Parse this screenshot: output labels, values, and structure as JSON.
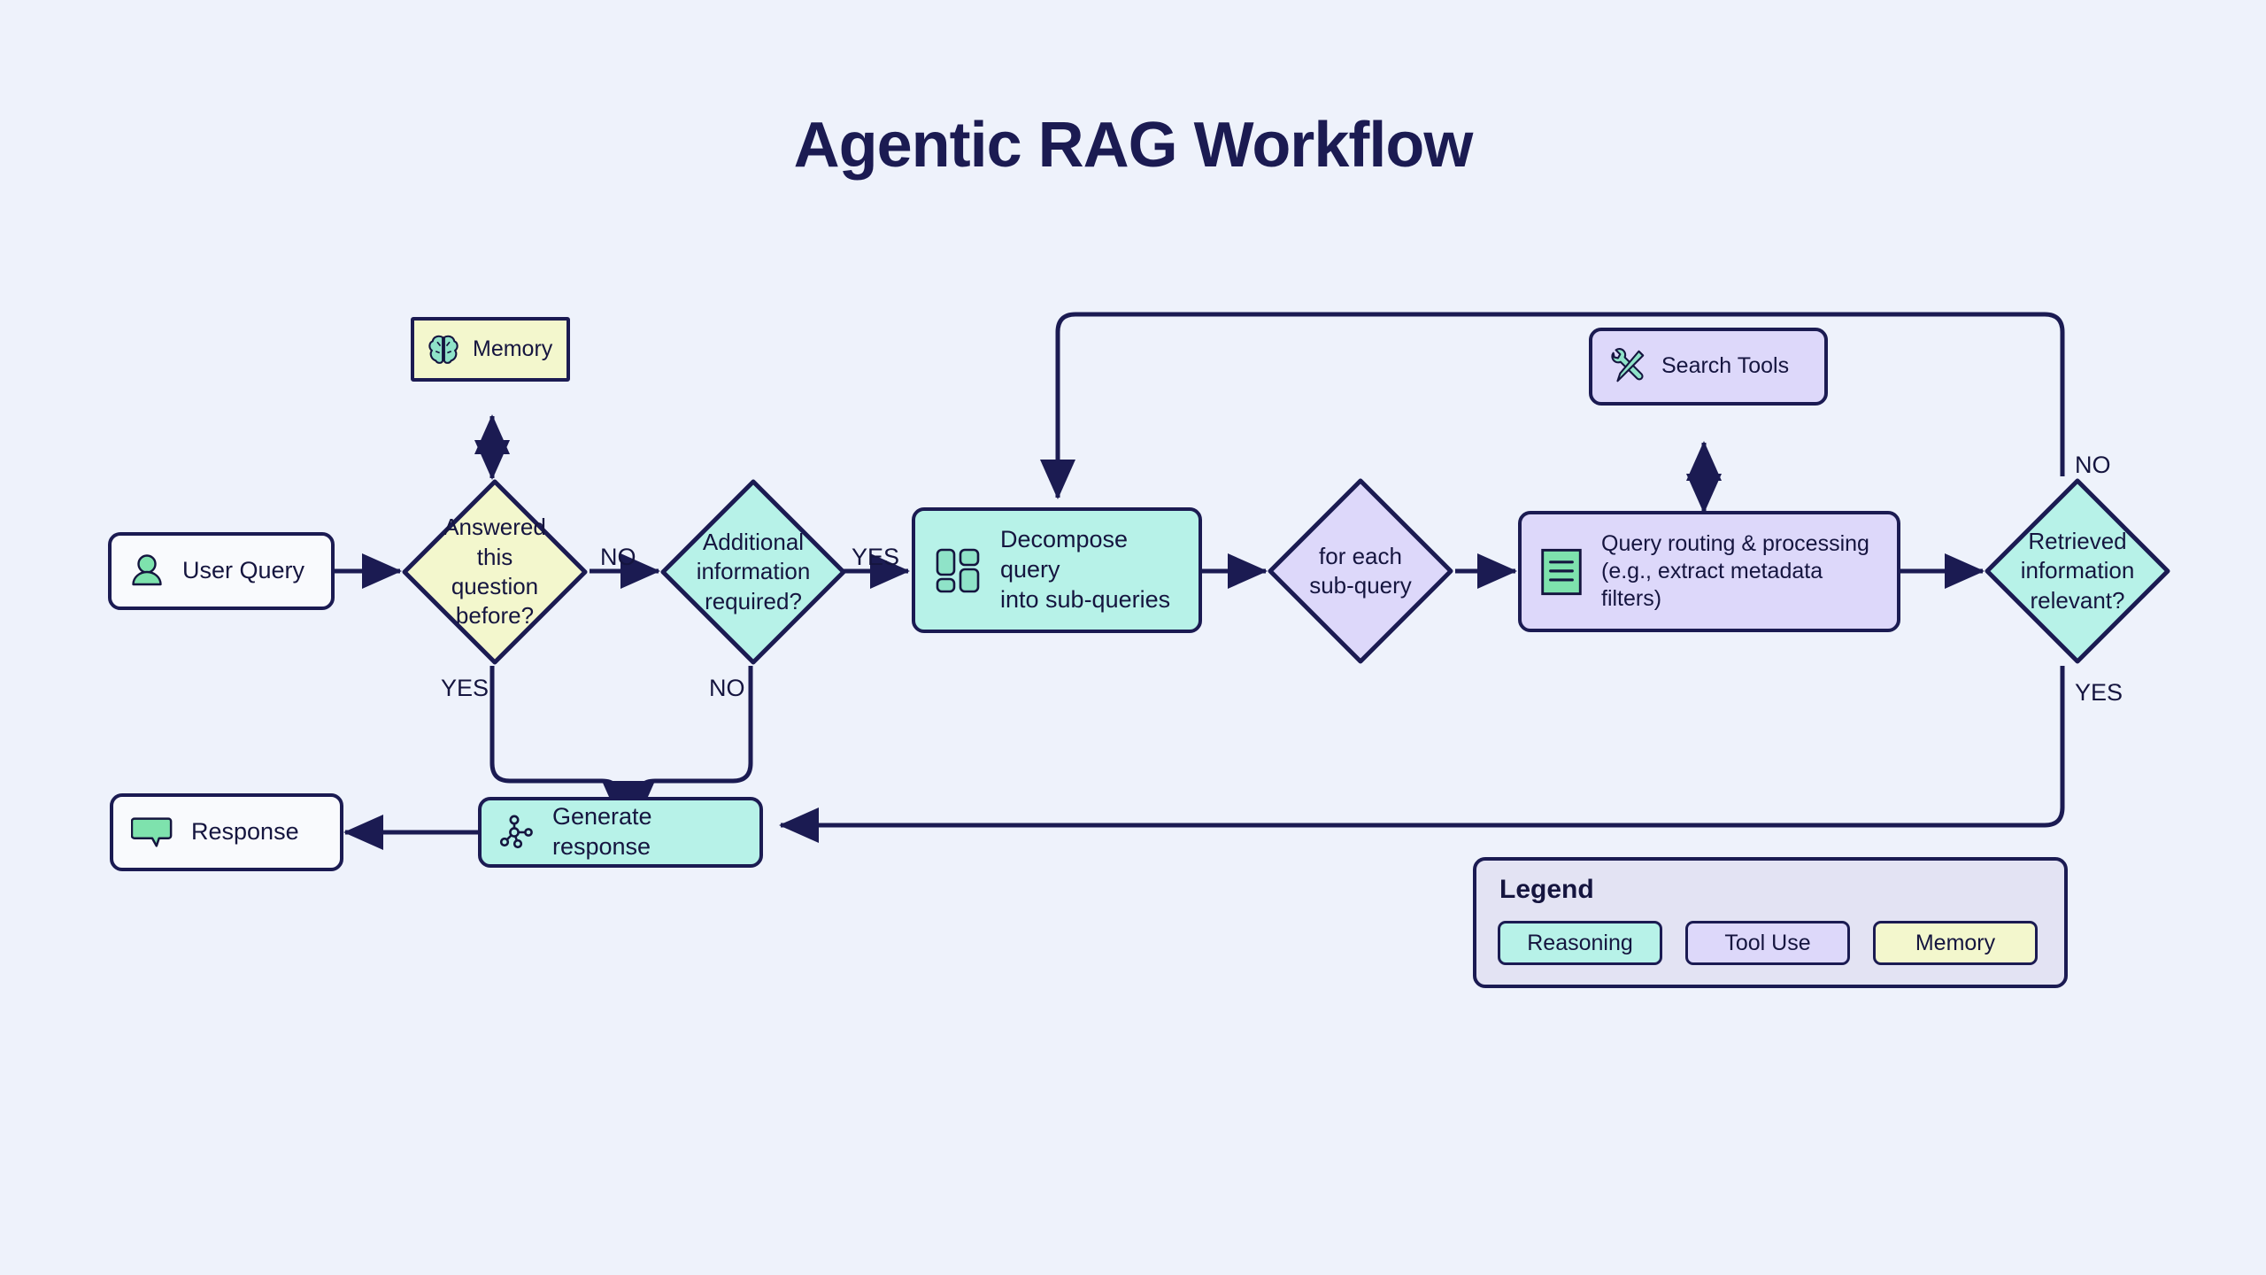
{
  "page": {
    "title": "Agentic RAG Workflow",
    "background_color": "#eef2fb",
    "stroke_color": "#1b1b52",
    "text_color": "#15153f"
  },
  "colors": {
    "reasoning": "#b7f2e8",
    "tool_use": "#ddd8fa",
    "memory": "#f3f7cd",
    "plain": "#f9fafd",
    "legend_panel": "#e3e3f3",
    "icon_green": "#7ee2ad",
    "icon_mint": "#8fe3c8"
  },
  "nodes": {
    "user_query": {
      "label": "User Query",
      "icon": "user-icon",
      "category": "plain"
    },
    "memory": {
      "label": "Memory",
      "icon": "brain-icon",
      "category": "memory"
    },
    "answered_before": {
      "label": "Answered\nthis\nquestion\nbefore?",
      "category": "memory"
    },
    "additional_info": {
      "label": "Additional\ninformation\nrequired?",
      "category": "reasoning"
    },
    "decompose": {
      "label": "Decompose query\ninto sub-queries",
      "icon": "blocks-icon",
      "category": "reasoning"
    },
    "for_each": {
      "label": "for each\nsub-query",
      "category": "tool_use"
    },
    "search_tools": {
      "label": "Search Tools",
      "icon": "tools-icon",
      "category": "tool_use"
    },
    "query_routing": {
      "label": "Query routing & processing\n(e.g., extract metadata\nfilters)",
      "icon": "document-icon",
      "category": "tool_use"
    },
    "retrieved_relevant": {
      "label": "Retrieved\ninformation\nrelevant?",
      "category": "reasoning"
    },
    "generate_response": {
      "label": "Generate response",
      "icon": "network-icon",
      "category": "reasoning"
    },
    "response": {
      "label": "Response",
      "icon": "speech-bubble-icon",
      "category": "plain"
    }
  },
  "edge_labels": {
    "answered_no": "NO",
    "answered_yes": "YES",
    "additional_yes": "YES",
    "additional_no": "NO",
    "retrieved_no": "NO",
    "retrieved_yes": "YES"
  },
  "legend": {
    "title": "Legend",
    "items": [
      {
        "label": "Reasoning",
        "color": "#b7f2e8"
      },
      {
        "label": "Tool Use",
        "color": "#ddd8fa"
      },
      {
        "label": "Memory",
        "color": "#f3f7cd"
      }
    ]
  }
}
